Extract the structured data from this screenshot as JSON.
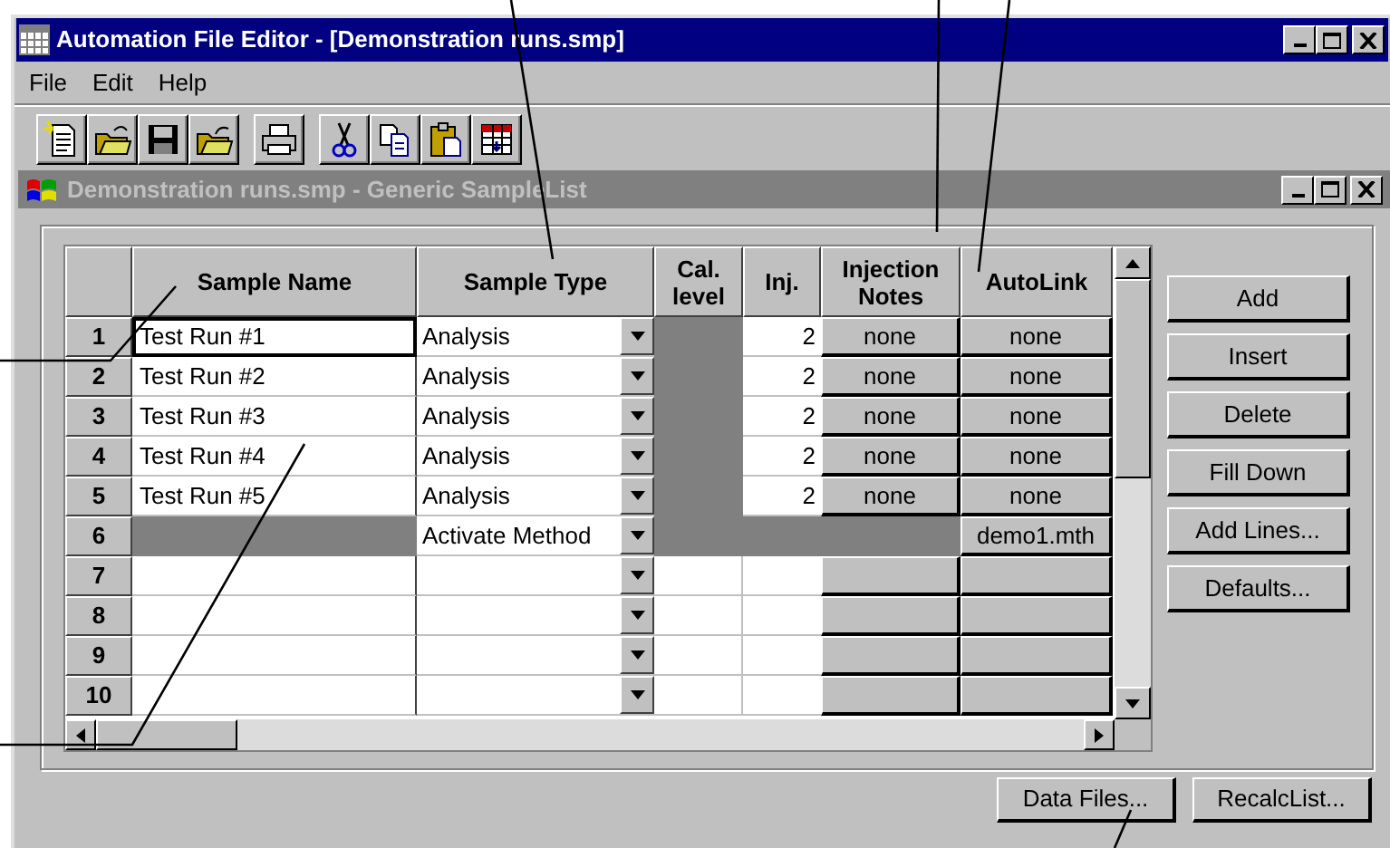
{
  "window": {
    "title": "Automation File Editor - [Demonstration runs.smp]"
  },
  "menu": [
    {
      "label": "File"
    },
    {
      "label": "Edit"
    },
    {
      "label": "Help"
    }
  ],
  "toolbar": [
    {
      "kind": "new"
    },
    {
      "kind": "open"
    },
    {
      "kind": "save"
    },
    {
      "kind": "open-arrow"
    },
    {
      "kind": "separator"
    },
    {
      "kind": "print"
    },
    {
      "kind": "separator"
    },
    {
      "kind": "cut"
    },
    {
      "kind": "copy"
    },
    {
      "kind": "paste"
    },
    {
      "kind": "table"
    }
  ],
  "document": {
    "title": "Demonstration runs.smp - Generic SampleList"
  },
  "table": {
    "columns": [
      "Sample Name",
      "Sample Type",
      "Cal. level",
      "Inj.",
      "Injection Notes",
      "AutoLink"
    ],
    "rows": [
      {
        "number": "1",
        "name": "Test Run #1",
        "type": "Analysis",
        "inj": "2",
        "notes": "none",
        "autolink": "none",
        "kind": "analysis",
        "focused": true
      },
      {
        "number": "2",
        "name": "Test Run #2",
        "type": "Analysis",
        "inj": "2",
        "notes": "none",
        "autolink": "none",
        "kind": "analysis",
        "focused": false
      },
      {
        "number": "3",
        "name": "Test Run #3",
        "type": "Analysis",
        "inj": "2",
        "notes": "none",
        "autolink": "none",
        "kind": "analysis",
        "focused": false
      },
      {
        "number": "4",
        "name": "Test Run #4",
        "type": "Analysis",
        "inj": "2",
        "notes": "none",
        "autolink": "none",
        "kind": "analysis",
        "focused": false
      },
      {
        "number": "5",
        "name": "Test Run #5",
        "type": "Analysis",
        "inj": "2",
        "notes": "none",
        "autolink": "none",
        "kind": "analysis",
        "focused": false
      },
      {
        "number": "6",
        "type": "Activate Method",
        "autolink": "demo1.mth",
        "kind": "method",
        "focused": false
      },
      {
        "number": "7",
        "kind": "empty",
        "focused": false
      },
      {
        "number": "8",
        "kind": "empty",
        "focused": false
      },
      {
        "number": "9",
        "kind": "empty",
        "focused": false
      },
      {
        "number": "10",
        "kind": "empty",
        "focused": false
      }
    ]
  },
  "side_buttons": [
    {
      "label": "Add"
    },
    {
      "label": "Insert"
    },
    {
      "label": "Delete"
    },
    {
      "label": "Fill Down"
    },
    {
      "label": "Add Lines..."
    },
    {
      "label": "Defaults..."
    }
  ],
  "bottom_buttons": [
    {
      "label": "Data Files..."
    },
    {
      "label": "RecalcList..."
    }
  ]
}
